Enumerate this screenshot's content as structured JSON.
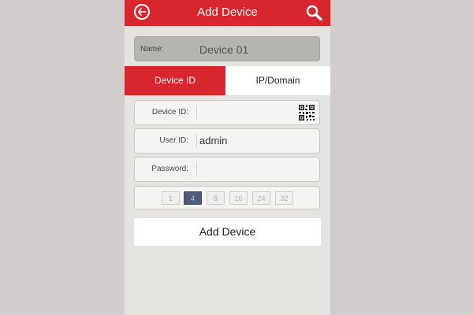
{
  "header": {
    "title": "Add Device",
    "back_icon": "arrow-left-circle-icon",
    "search_icon": "search-icon",
    "color": "#d8262f"
  },
  "name_field": {
    "label": "Name:",
    "value": "Device 01"
  },
  "tabs": [
    {
      "label": "Device ID",
      "active": true
    },
    {
      "label": "IP/Domain",
      "active": false
    }
  ],
  "form": {
    "device_id": {
      "label": "Device ID:",
      "value": "",
      "icon": "qr-code-icon"
    },
    "user_id": {
      "label": "User ID:",
      "value": "admin"
    },
    "password": {
      "label": "Password:",
      "value": ""
    }
  },
  "channels": {
    "options": [
      "1",
      "4",
      "8",
      "16",
      "24",
      "32"
    ],
    "selected": "4"
  },
  "add_button": {
    "label": "Add Device"
  }
}
